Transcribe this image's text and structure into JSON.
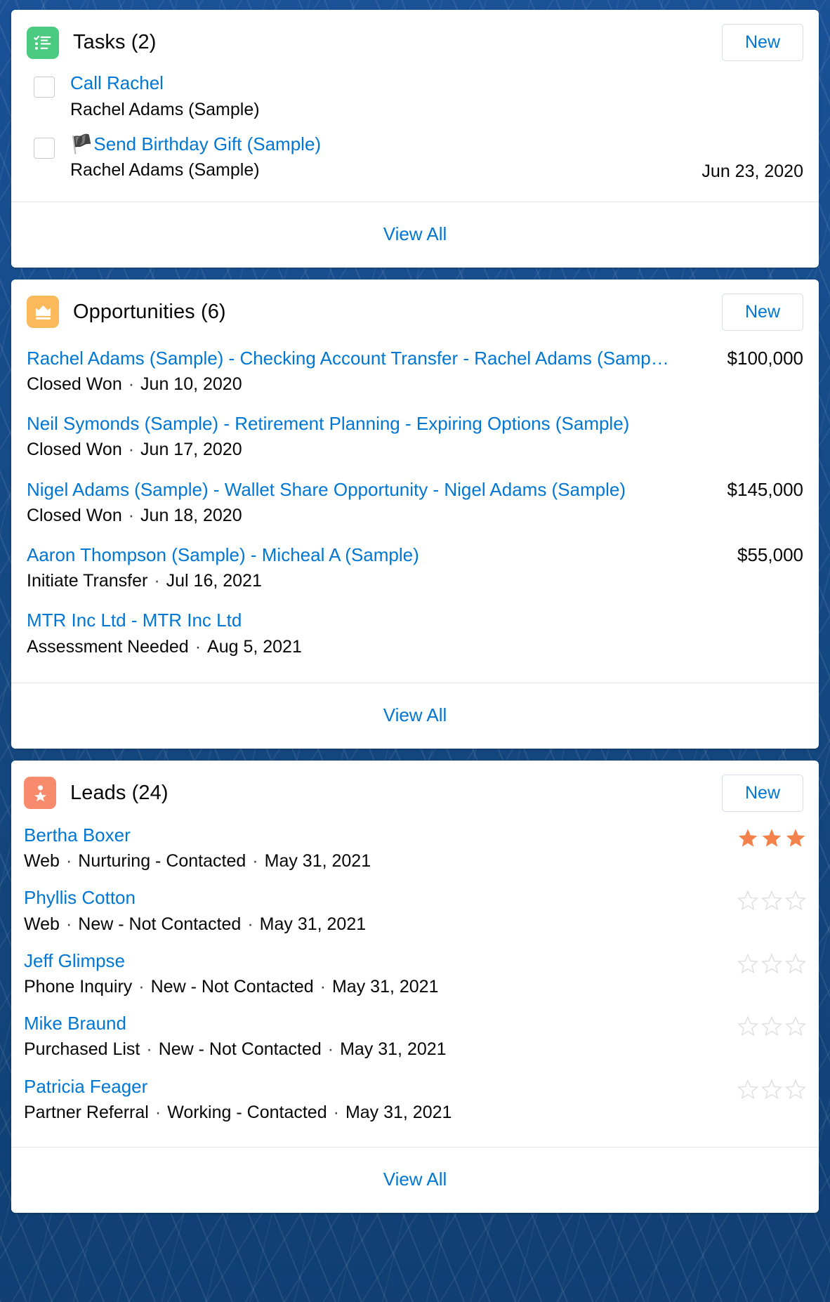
{
  "theme": {
    "link_color": "#0176d3",
    "text_color": "#080707",
    "tasks_icon_bg": "#4bca81",
    "opportunities_icon_bg": "#fcb95b",
    "leads_icon_bg": "#f88b6d",
    "star_filled_color": "#f2814c",
    "star_empty_color": "#e0e0e0",
    "flag_color": "#ba0517",
    "page_background": "#1b5297"
  },
  "tasks_card": {
    "icon": "task-list-icon",
    "title": "Tasks (2)",
    "new_label": "New",
    "view_all_label": "View All",
    "items": [
      {
        "title": "Call Rachel",
        "flagged": false,
        "subtitle": "Rachel Adams (Sample)",
        "date": "",
        "checked": false
      },
      {
        "title": "Send Birthday Gift (Sample)",
        "flagged": true,
        "subtitle": "Rachel Adams (Sample)",
        "date": "Jun 23, 2020",
        "checked": false
      }
    ]
  },
  "opportunities_card": {
    "icon": "crown-icon",
    "title": "Opportunities (6)",
    "new_label": "New",
    "view_all_label": "View All",
    "items": [
      {
        "name": "Rachel Adams (Sample) - Checking Account Transfer - Rachel Adams (Samp…",
        "stage": "Closed Won",
        "date": "Jun 10, 2020",
        "amount": "$100,000"
      },
      {
        "name": "Neil Symonds (Sample) - Retirement Planning - Expiring Options (Sample)",
        "stage": "Closed Won",
        "date": "Jun 17, 2020",
        "amount": ""
      },
      {
        "name": "Nigel Adams (Sample) - Wallet Share Opportunity - Nigel Adams (Sample)",
        "stage": "Closed Won",
        "date": "Jun 18, 2020",
        "amount": "$145,000"
      },
      {
        "name": "Aaron Thompson (Sample) - Micheal A (Sample)",
        "stage": "Initiate Transfer",
        "date": "Jul 16, 2021",
        "amount": "$55,000"
      },
      {
        "name": "MTR Inc Ltd - MTR Inc Ltd",
        "stage": "Assessment Needed",
        "date": "Aug 5, 2021",
        "amount": ""
      }
    ]
  },
  "leads_card": {
    "icon": "lead-person-icon",
    "title": "Leads (24)",
    "new_label": "New",
    "view_all_label": "View All",
    "rating_max": 3,
    "items": [
      {
        "name": "Bertha Boxer",
        "source": "Web",
        "status": "Nurturing - Contacted",
        "date": "May 31, 2021",
        "rating": 3
      },
      {
        "name": "Phyllis Cotton",
        "source": "Web",
        "status": "New - Not Contacted",
        "date": "May 31, 2021",
        "rating": 0
      },
      {
        "name": "Jeff Glimpse",
        "source": "Phone Inquiry",
        "status": "New - Not Contacted",
        "date": "May 31, 2021",
        "rating": 0
      },
      {
        "name": "Mike Braund",
        "source": "Purchased List",
        "status": "New - Not Contacted",
        "date": "May 31, 2021",
        "rating": 0
      },
      {
        "name": "Patricia Feager",
        "source": "Partner Referral",
        "status": "Working - Contacted",
        "date": "May 31, 2021",
        "rating": 0
      }
    ]
  }
}
